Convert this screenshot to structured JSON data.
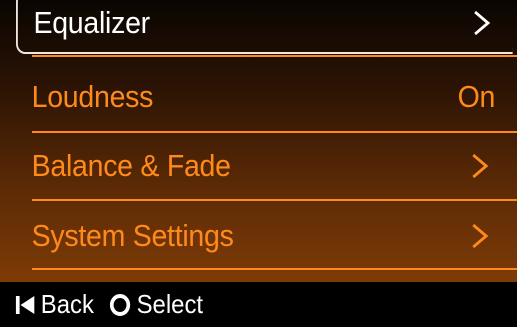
{
  "menu": {
    "items": [
      {
        "label": "Equalizer",
        "value": "",
        "chevron": true,
        "selected": true
      },
      {
        "label": "Loudness",
        "value": "On",
        "chevron": false,
        "selected": false
      },
      {
        "label": "Balance & Fade",
        "value": "",
        "chevron": true,
        "selected": false
      },
      {
        "label": "System Settings",
        "value": "",
        "chevron": true,
        "selected": false
      }
    ]
  },
  "footer": {
    "back_label": "Back",
    "back_icon": "skip-back-icon",
    "select_label": "Select",
    "select_icon": "circle-select-icon"
  },
  "colors": {
    "accent": "#ff8a1c",
    "selected_text": "#ffffff",
    "background_top": "#0a0502",
    "background_bottom": "#7e3b06"
  }
}
